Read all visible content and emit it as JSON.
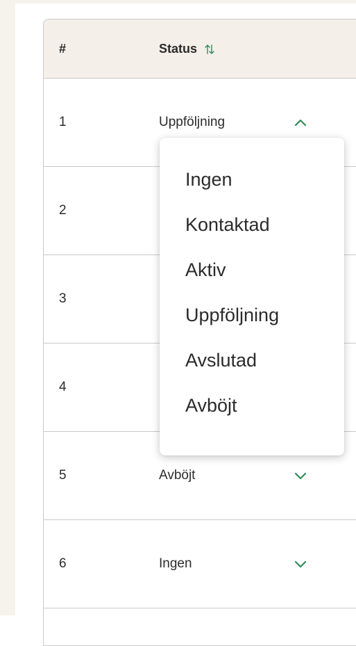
{
  "table": {
    "header": {
      "index_label": "#",
      "status_label": "Status"
    },
    "rows": [
      {
        "index": "1",
        "status": "Uppföljning",
        "expanded": true
      },
      {
        "index": "2",
        "status": "",
        "expanded": false
      },
      {
        "index": "3",
        "status": "",
        "expanded": false
      },
      {
        "index": "4",
        "status": "",
        "expanded": false
      },
      {
        "index": "5",
        "status": "Avböjt",
        "expanded": false
      },
      {
        "index": "6",
        "status": "Ingen",
        "expanded": false
      }
    ]
  },
  "status_dropdown": {
    "options": [
      "Ingen",
      "Kontaktad",
      "Aktiv",
      "Uppföljning",
      "Avslutad",
      "Avböjt"
    ]
  },
  "colors": {
    "accent": "#2e8b57",
    "header_bg": "#f4efe8",
    "page_bg": "#f6f2ec",
    "border": "#c9c9c9",
    "text": "#2b2b2b"
  },
  "icons": {
    "sort": "sort-arrows-icon",
    "expanded": "chevron-up-icon",
    "collapsed": "chevron-down-icon"
  }
}
